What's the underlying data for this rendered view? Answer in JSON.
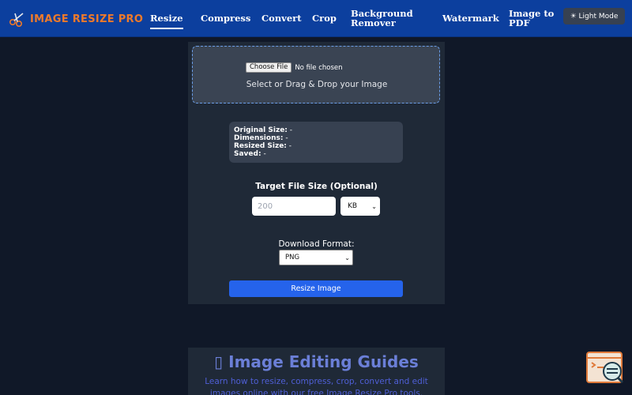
{
  "header": {
    "logo_text": "IMAGE RESIZE PRO",
    "nav": [
      {
        "label": "Resize",
        "active": true
      },
      {
        "label": "Compress"
      },
      {
        "label": "Convert"
      },
      {
        "label": "Crop"
      },
      {
        "label": "Background Remover"
      },
      {
        "label": "Watermark"
      },
      {
        "label": "Image to PDF"
      }
    ],
    "theme_button": "☀ Light Mode"
  },
  "upload": {
    "choose_button": "Choose File",
    "file_status": "No file chosen",
    "drop_text": "Select or Drag & Drop your Image"
  },
  "stats": {
    "original_label": "Original Size:",
    "original_value": "-",
    "dimensions_label": "Dimensions:",
    "dimensions_value": "-",
    "resized_label": "Resized Size:",
    "resized_value": "-",
    "saved_label": "Saved:",
    "saved_value": "-"
  },
  "target": {
    "label": "Target File Size (Optional)",
    "placeholder": "200",
    "unit": "KB"
  },
  "format": {
    "label": "Download Format:",
    "selected": "PNG"
  },
  "resize_button": "Resize Image",
  "guides": {
    "title": "▯ Image Editing Guides",
    "subtitle": "Learn how to resize, compress, crop, convert and edit images online with our free Image Resize Pro tools."
  },
  "colors": {
    "header_bg": "#0c3f9e",
    "page_bg": "#101828",
    "panel_bg": "#1f2937",
    "accent_orange": "#ee7a2a",
    "primary_button": "#2563eb"
  }
}
